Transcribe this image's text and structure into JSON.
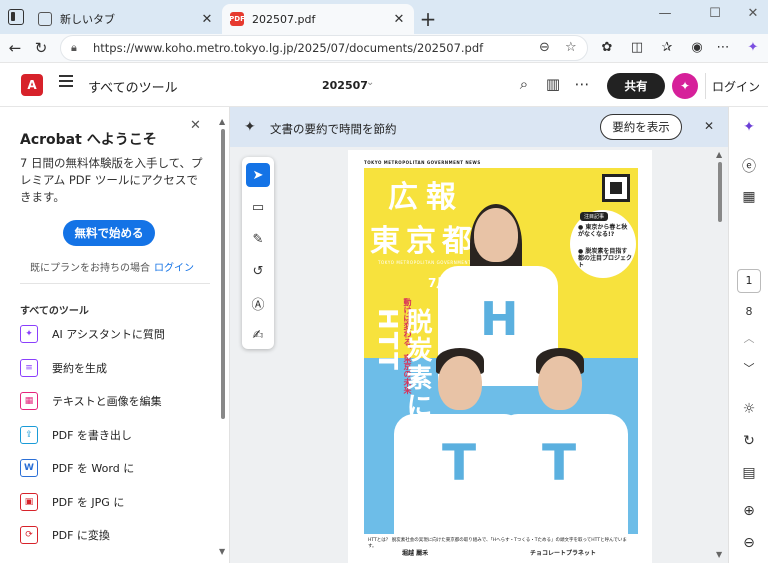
{
  "browser": {
    "tabs": [
      {
        "label": "新しいタブ",
        "active": false
      },
      {
        "label": "202507.pdf",
        "active": true
      }
    ],
    "favicon_pdf_text": "PDF",
    "url": "https://www.koho.metro.tokyo.lg.jp/2025/07/documents/202507.pdf",
    "icons": [
      "back-icon",
      "reload-icon",
      "lock-icon",
      "zoom-icon",
      "star-icon",
      "extensions-icon",
      "split-screen-icon",
      "favorites-icon",
      "profile-icon",
      "more-icon",
      "copilot-icon"
    ]
  },
  "toolbar": {
    "all_tools": "すべてのツール",
    "doc_title": "202507",
    "share_label": "共有",
    "login_label": "ログイン",
    "adobe_logo_text": "A"
  },
  "left_panel": {
    "welcome": "Acrobat へようこそ",
    "description": "7 日間の無料体験版を入手して、プレミアム PDF ツールにアクセスできます。",
    "start_button": "無料で始める",
    "plan_text": "既にプランをお持ちの場合",
    "plan_login": "ログイン",
    "all_tools_heading": "すべてのツール",
    "tools": [
      {
        "label": "AI アシスタントに質問",
        "icon": "ai-assistant-icon",
        "color": "#8a3ffc",
        "glyph": "✦"
      },
      {
        "label": "要約を生成",
        "icon": "summary-icon",
        "color": "#8a3ffc",
        "glyph": "≡"
      },
      {
        "label": "テキストと画像を編集",
        "icon": "edit-icon",
        "color": "#e5247c",
        "glyph": "▦"
      },
      {
        "label": "PDF を書き出し",
        "icon": "export-icon",
        "color": "#1a9bd7",
        "glyph": "⇪"
      },
      {
        "label": "PDF を Word に",
        "icon": "word-icon",
        "color": "#2b6fd6",
        "glyph": "W"
      },
      {
        "label": "PDF を JPG に",
        "icon": "jpg-icon",
        "color": "#d7222a",
        "glyph": "▣"
      },
      {
        "label": "PDF に変換",
        "icon": "convert-icon",
        "color": "#d7222a",
        "glyph": "⟳"
      }
    ]
  },
  "banner": {
    "text": "文書の要約で時間を節約",
    "button": "要約を表示"
  },
  "page_nav": {
    "current": "1",
    "total": "8"
  },
  "poster": {
    "header": "TOKYO METROPOLITAN GOVERNMENT NEWS",
    "title1": "広報",
    "title2": "東京都",
    "english": "TOKYO METROPOLITAN GOVERNMENT NEWS",
    "month": "7月",
    "catch": "動けば変わる、東京の未来",
    "headline": "脱炭素に向けてHTT",
    "bubble_tag": "注目記事",
    "bubble_line1": "● 東京から春と秋がなくなる!?",
    "bubble_line2": "● 脱炭素を目指す都の注目プロジェクト",
    "footer_text": "HTTとは？ 脱炭素社会の実現に向けた東京都の取り組みで、「Hへらす・Tつくる・Tためる」の頭文字を取ってHTTと呼んでいます。",
    "footer_name1": "堀越 麗禾",
    "footer_name2": "チョコレートプラネット"
  },
  "colors": {
    "accent": "#1473e6",
    "share_bg": "#222222",
    "banner_bg": "#dbe6f3",
    "poster_yellow": "#f7e23d",
    "poster_blue": "#6dbde8"
  }
}
